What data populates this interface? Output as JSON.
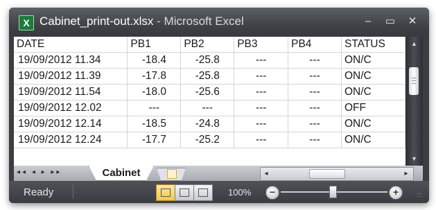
{
  "window": {
    "file_name": "Cabinet_print-out.xlsx",
    "separator": " - ",
    "app_name": "Microsoft Excel",
    "minimize_glyph": "–",
    "maximize_glyph": "▭",
    "close_glyph": "✕"
  },
  "sheet": {
    "headers": [
      "DATE",
      "PB1",
      "PB2",
      "PB3",
      "PB4",
      "STATUS"
    ],
    "rows": [
      {
        "date": "19/09/2012 11.34",
        "pb1": "-18.4",
        "pb2": "-25.8",
        "pb3": "---",
        "pb4": "---",
        "status": "ON/C"
      },
      {
        "date": "19/09/2012 11.39",
        "pb1": "-17.8",
        "pb2": "-25.8",
        "pb3": "---",
        "pb4": "---",
        "status": "ON/C"
      },
      {
        "date": "19/09/2012 11.54",
        "pb1": "-18.0",
        "pb2": "-25.6",
        "pb3": "---",
        "pb4": "---",
        "status": "ON/C"
      },
      {
        "date": "19/09/2012 12.02",
        "pb1": "---",
        "pb2": "---",
        "pb3": "---",
        "pb4": "---",
        "status": "OFF"
      },
      {
        "date": "19/09/2012 12.14",
        "pb1": "-18.5",
        "pb2": "-24.8",
        "pb3": "---",
        "pb4": "---",
        "status": "ON/C"
      },
      {
        "date": "19/09/2012 12.24",
        "pb1": "-17.7",
        "pb2": "-25.2",
        "pb3": "---",
        "pb4": "---",
        "status": "ON/C"
      }
    ]
  },
  "tabs": {
    "nav_glyphs": "◂◂ ◂ ▸ ▸▸",
    "active_tab": "Cabinet"
  },
  "status_bar": {
    "status": "Ready",
    "zoom": "100%",
    "zoom_minus": "−",
    "zoom_plus": "+"
  },
  "colors": {
    "excel_green": "#1e7a3c",
    "chrome_dark": "#3a3d42",
    "active_view": "#f7c74b"
  },
  "icons": [
    "excel-app-icon",
    "minimize-icon",
    "maximize-icon",
    "close-icon",
    "scroll-up-icon",
    "scroll-down-icon",
    "insert-sheet-icon",
    "normal-view-icon",
    "page-layout-icon",
    "page-break-icon",
    "zoom-out-icon",
    "zoom-in-icon",
    "resize-grip-icon"
  ]
}
